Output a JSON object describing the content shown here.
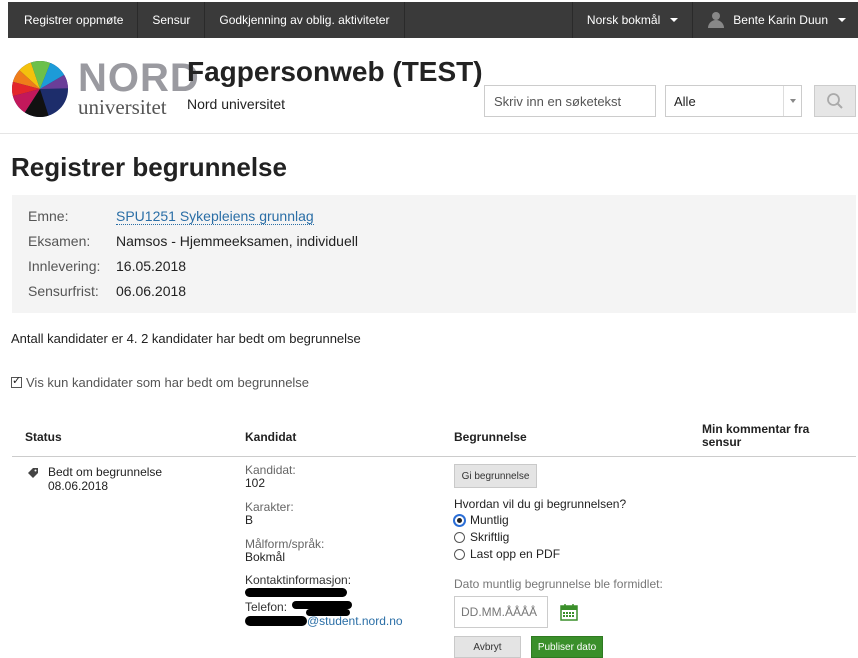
{
  "topnav": {
    "items": [
      "Registrer oppmøte",
      "Sensur",
      "Godkjenning av oblig. aktiviteter"
    ],
    "language": "Norsk bokmål",
    "user": "Bente Karin Duun"
  },
  "header": {
    "logo_nord": "NORD",
    "logo_universitet": "universitet",
    "app_title": "Fagpersonweb (TEST)",
    "app_subtitle": "Nord universitet",
    "search_placeholder": "Skriv inn en søketekst",
    "filter_selected": "Alle"
  },
  "page": {
    "title": "Registrer begrunnelse",
    "info": [
      {
        "label": "Emne:",
        "value": "SPU1251 Sykepleiens grunnlag"
      },
      {
        "label": "Eksamen:",
        "value": "Namsos - Hjemmeeksamen, individuell"
      },
      {
        "label": "Innlevering:",
        "value": "16.05.2018"
      },
      {
        "label": "Sensurfrist:",
        "value": "06.06.2018"
      }
    ],
    "count_text": "Antall kandidater er 4. 2 kandidater har bedt om begrunnelse",
    "filter_checkbox_label": "Vis kun kandidater som har bedt om begrunnelse",
    "filter_checked": true
  },
  "table": {
    "headers": {
      "status": "Status",
      "kandidat": "Kandidat",
      "begrunnelse": "Begrunnelse",
      "kommentar": "Min kommentar fra sensur"
    },
    "row": {
      "status": "Bedt om begrunnelse",
      "status_date": "08.06.2018",
      "kandidat_label": "Kandidat:",
      "kandidat_value": "102",
      "karakter_label": "Karakter:",
      "karakter_value": "B",
      "malform_label": "Målform/språk:",
      "malform_value": "Bokmål",
      "kontakt_label": "Kontaktinformasjon:",
      "telefon_label": "Telefon:",
      "email_suffix": "@student.nord.no",
      "gi_button": "Gi begrunnelse",
      "question": "Hvordan vil du gi begrunnelsen?",
      "options": [
        "Muntlig",
        "Skriftlig",
        "Last opp en PDF"
      ],
      "selected_option": "Muntlig",
      "date_label": "Dato muntlig begrunnelse ble formidlet:",
      "date_placeholder": "DD.MM.ÅÅÅÅ",
      "cancel_button": "Avbryt",
      "publish_button": "Publiser dato"
    }
  },
  "colors": {
    "nav_bg": "#3a3a3a",
    "link": "#2a6ea6",
    "primary_button": "#3a8f2a",
    "info_bg": "#f4f4f4"
  }
}
